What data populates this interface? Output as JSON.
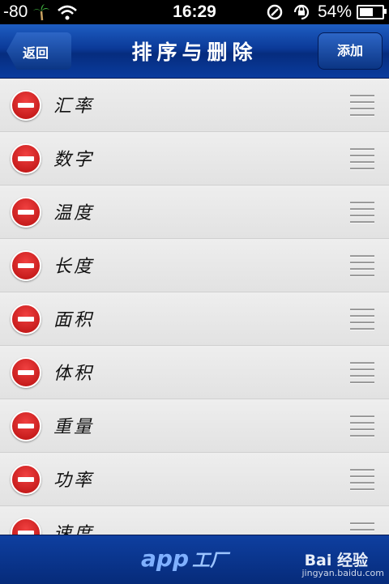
{
  "status": {
    "signal": "-80",
    "time": "16:29",
    "battery": "54%",
    "battery_level": 0.54
  },
  "navbar": {
    "title": "排序与删除",
    "back_label": "返回",
    "add_label": "添加"
  },
  "items": [
    {
      "label": "汇率"
    },
    {
      "label": "数字"
    },
    {
      "label": "温度"
    },
    {
      "label": "长度"
    },
    {
      "label": "面积"
    },
    {
      "label": "体积"
    },
    {
      "label": "重量"
    },
    {
      "label": "功率"
    },
    {
      "label": "速度"
    }
  ],
  "footer": {
    "logo": "app",
    "logo_cn": "工厂",
    "watermark": "Bai 经验",
    "watermark_url": "jingyan.baidu.com"
  },
  "icons": {
    "delete": "minus-circle-icon",
    "reorder": "grip-lines-icon"
  },
  "colors": {
    "nav": "#0b3a98",
    "delete": "#cc1a1a"
  }
}
